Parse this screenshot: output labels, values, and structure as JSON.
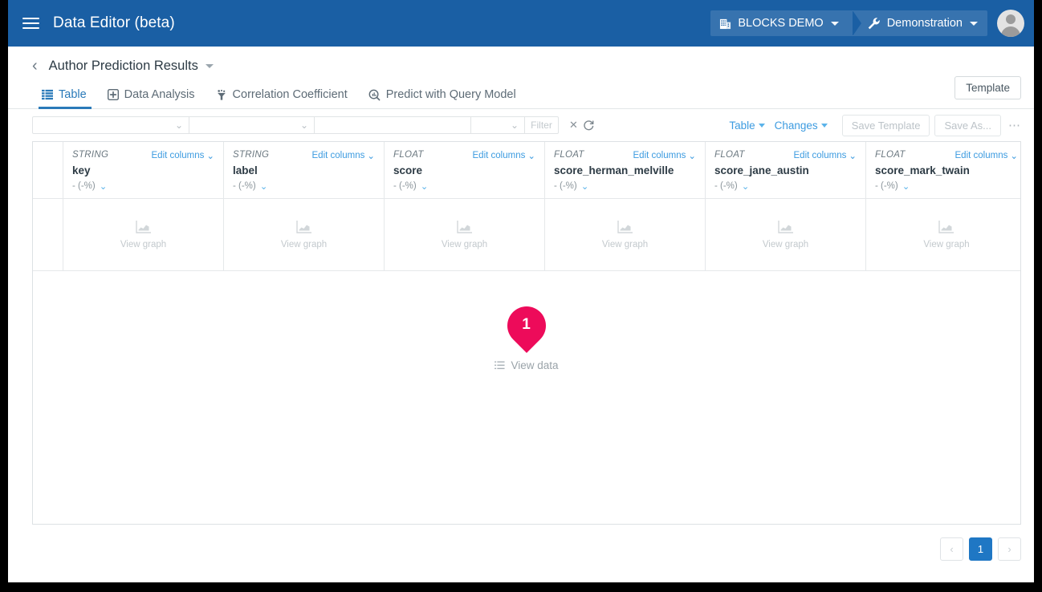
{
  "appbar": {
    "menu_icon": "hamburger-icon",
    "title": "Data Editor (beta)",
    "project_chip": {
      "icon": "building-icon",
      "label": "BLOCKS DEMO"
    },
    "env_chip": {
      "icon": "wrench-icon",
      "label": "Demonstration"
    },
    "avatar": "user-avatar",
    "bg_color": "#1a5fa4"
  },
  "breadcrumb": {
    "back_icon": "chevron-left-icon",
    "title": "Author Prediction Results"
  },
  "tabs": [
    {
      "label": "Table",
      "icon": "table-icon",
      "active": true
    },
    {
      "label": "Data Analysis",
      "icon": "data-analysis-icon",
      "active": false
    },
    {
      "label": "Correlation Coefficient",
      "icon": "correlation-icon",
      "active": false
    },
    {
      "label": "Predict with Query Model",
      "icon": "predict-icon",
      "active": false
    }
  ],
  "template_button": "Template",
  "toolbar": {
    "select_1": "",
    "select_2": "",
    "text_input": "",
    "select_3": "",
    "filter_button": "Filter",
    "clear_icon": "clear-x-icon",
    "refresh_icon": "refresh-icon",
    "table_menu": "Table",
    "changes_menu": "Changes",
    "save_template": "Save Template",
    "save_as": "Save As...",
    "overflow": "⋯"
  },
  "table": {
    "edit_columns_label": "Edit columns",
    "stat_label": "- (-%)",
    "view_graph_label": "View graph",
    "columns": [
      {
        "type": "STRING",
        "name": "key"
      },
      {
        "type": "STRING",
        "name": "label"
      },
      {
        "type": "FLOAT",
        "name": "score"
      },
      {
        "type": "FLOAT",
        "name": "score_herman_melville"
      },
      {
        "type": "FLOAT",
        "name": "score_jane_austin"
      },
      {
        "type": "FLOAT",
        "name": "score_mark_twain"
      }
    ]
  },
  "empty_state": {
    "pin_number": "1",
    "pin_color": "#ed0b5a",
    "view_data_label": "View data",
    "list_icon": "list-icon"
  },
  "pagination": {
    "prev": "‹",
    "next": "›",
    "pages": [
      "1"
    ],
    "current": "1"
  }
}
